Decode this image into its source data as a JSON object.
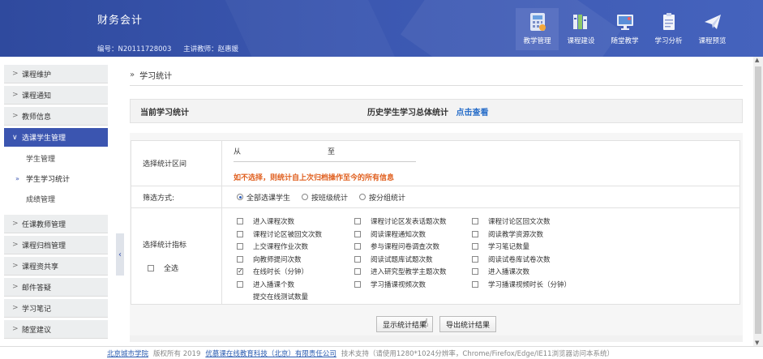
{
  "header": {
    "course_title": "财务会计",
    "course_code": "编号：N20111728003",
    "teacher": "主讲教师：赵惠媛",
    "nav": [
      {
        "label": "教学管理",
        "icon": "calculator-icon",
        "active": true
      },
      {
        "label": "课程建设",
        "icon": "books-icon",
        "active": false
      },
      {
        "label": "随堂教学",
        "icon": "monitor-icon",
        "active": false
      },
      {
        "label": "学习分析",
        "icon": "clipboard-icon",
        "active": false
      },
      {
        "label": "课程预览",
        "icon": "paper-plane-icon",
        "active": false
      }
    ]
  },
  "sidebar": {
    "items": [
      {
        "label": "课程维护"
      },
      {
        "label": "课程通知"
      },
      {
        "label": "教师信息"
      },
      {
        "label": "选课学生管理",
        "open": true,
        "children": [
          {
            "label": "学生管理"
          },
          {
            "label": "学生学习统计",
            "current": true
          },
          {
            "label": "成绩管理"
          }
        ]
      },
      {
        "label": "任课教师管理"
      },
      {
        "label": "课程归档管理"
      },
      {
        "label": "课程资共享"
      },
      {
        "label": "邮件答疑"
      },
      {
        "label": "学习笔记"
      },
      {
        "label": "随堂建议"
      }
    ]
  },
  "main": {
    "breadcrumb": "学习统计",
    "current_stats_title": "当前学习统计",
    "history_label": "历史学生学习总体统计",
    "history_link": "点击查看",
    "range_label": "选择统计区间",
    "from_label": "从",
    "to_label": "至",
    "range_tip": "如不选择，则统计自上次归档操作至今的所有信息",
    "filter_label": "筛选方式:",
    "filter_options": [
      {
        "label": "全部选课学生",
        "selected": true
      },
      {
        "label": "按班级统计",
        "selected": false
      },
      {
        "label": "按分组统计",
        "selected": false
      }
    ],
    "metrics_label": "选择统计指标",
    "select_all_label": "全选",
    "metrics_col1": [
      {
        "label": "进入课程次数",
        "checked": false
      },
      {
        "label": "课程讨论区被回文次数",
        "checked": false
      },
      {
        "label": "上交课程作业次数",
        "checked": false
      },
      {
        "label": "向教师提问次数",
        "checked": false
      },
      {
        "label": "在线时长（分钟）",
        "checked": true
      },
      {
        "label": "进入播课个数",
        "checked": false
      },
      {
        "label": "提交在线测试数量",
        "checked": false
      }
    ],
    "metrics_col2": [
      {
        "label": "课程讨论区发表话题次数",
        "checked": false
      },
      {
        "label": "阅读课程通知次数",
        "checked": false
      },
      {
        "label": "参与课程问卷调查次数",
        "checked": false
      },
      {
        "label": "阅读试题库试题次数",
        "checked": false
      },
      {
        "label": "进入研究型教学主题次数",
        "checked": false
      },
      {
        "label": "学习播课视频次数",
        "checked": false
      }
    ],
    "metrics_col3": [
      {
        "label": "课程讨论区回文次数",
        "checked": false
      },
      {
        "label": "阅读教学资源次数",
        "checked": false
      },
      {
        "label": "学习笔记数量",
        "checked": false
      },
      {
        "label": "阅读试卷库试卷次数",
        "checked": false
      },
      {
        "label": "进入播课次数",
        "checked": false
      },
      {
        "label": "学习播课视频时长（分钟）",
        "checked": false
      }
    ],
    "show_button": "显示统计结果",
    "export_button": "导出统计结果"
  },
  "footer": {
    "school": "北京城市学院",
    "rights": "版权所有 2019",
    "company": "优慕课在线教育科技（北京）有限责任公司",
    "support": "技术支持（请使用1280*1024分辨率，Chrome/Firefox/Edge/IE11浏览器访问本系统）"
  }
}
